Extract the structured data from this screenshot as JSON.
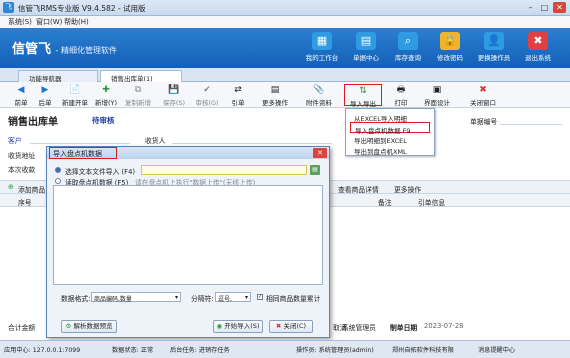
{
  "window": {
    "title": "信管飞RMS专业版 V9.4.582 - 试用版",
    "app_icon": "飞"
  },
  "menu": [
    "系统(S)",
    "窗口(W)",
    "帮助(H)"
  ],
  "banner": {
    "logo": "信管飞",
    "tagline": "- 精细化管理软件",
    "icons": [
      {
        "name": "workbench",
        "label": "我的工作台",
        "glyph": "▦",
        "color": "#2f9be3"
      },
      {
        "name": "document-center",
        "label": "单据中心",
        "glyph": "▤",
        "color": "#2f9be3"
      },
      {
        "name": "inventory-query",
        "label": "库存查询",
        "glyph": "⌕",
        "color": "#2f9be3"
      },
      {
        "name": "change-password",
        "label": "修改密码",
        "glyph": "🔒",
        "color": "#f0b42a"
      },
      {
        "name": "switch-operator",
        "label": "更换操作员",
        "glyph": "👤",
        "color": "#2f9be3"
      },
      {
        "name": "exit-system",
        "label": "退出系统",
        "glyph": "✖",
        "color": "#e04040"
      }
    ]
  },
  "tabs": [
    "功能导航器",
    "销售出库单(1)"
  ],
  "toolbar": [
    {
      "name": "prev",
      "label": "前单",
      "glyph": "◀"
    },
    {
      "name": "next",
      "label": "后单",
      "glyph": "▶"
    },
    {
      "name": "new-doc",
      "label": "新建开单",
      "glyph": "📄"
    },
    {
      "name": "add",
      "label": "新增(Y)",
      "glyph": "✚"
    },
    {
      "name": "copy-new",
      "label": "复制新增",
      "glyph": "⧉"
    },
    {
      "name": "save",
      "label": "保存(S)",
      "glyph": "💾"
    },
    {
      "name": "review",
      "label": "审核(G)",
      "glyph": "✔"
    },
    {
      "name": "reference",
      "label": "引单",
      "glyph": "⇄"
    },
    {
      "name": "more-ops",
      "label": "更多操作",
      "glyph": "▤"
    },
    {
      "name": "attachments",
      "label": "附件资料",
      "glyph": "📎"
    },
    {
      "name": "import-export",
      "label": "导入导出",
      "glyph": "⇅"
    },
    {
      "name": "print",
      "label": "打印",
      "glyph": "🖶"
    },
    {
      "name": "interface-design",
      "label": "界面设计",
      "glyph": "▣"
    },
    {
      "name": "close-window",
      "label": "关闭窗口",
      "glyph": "✖"
    }
  ],
  "form": {
    "title": "销售出库单",
    "reviewed": "待审核",
    "customer": "客户",
    "receiver": "收货人",
    "address": "收货地址",
    "this_time": "本次收款",
    "doc_no": "单据编号",
    "add_btn": "添加商品",
    "view_detail": "查看商品详情",
    "more_ops": "更多操作",
    "columns": [
      "序号",
      "备注",
      "引单信息"
    ],
    "total": "合计金额",
    "cancel_label": "取消",
    "operator": "系统管理员",
    "date_label": "制单日期",
    "date": "2023-07-28"
  },
  "dropdown": {
    "items": [
      "从EXCEL导入明细",
      "导入盘点机数据    F9",
      "导出明细到EXCEL",
      "导出到盘点机XML"
    ]
  },
  "dialog": {
    "title": "导入盘点机数据",
    "opt1": "选择文本文件导入 (F4)",
    "opt2": "读取盘点机数据 (F5)",
    "opt2_hint": "请在盘点机上执行\"数据上传\"(无线上传)",
    "format_label": "数据格式:",
    "format_value": "商品编码,数量",
    "sep_label": "分隔符:",
    "sep_value": "逗号,",
    "merge_label": "相同商品数量累计",
    "parse_btn": "解析数据预览",
    "start_btn": "开始导入(S)",
    "close_btn": "关闭(C)"
  },
  "status": {
    "server": "应用中心: 127.0.0.1:7099",
    "sync": "数据状态: 正常",
    "tasks": "后台任务: 进销存任务",
    "user": "操作员: 系统管理员(admin)",
    "company": "郑州自拓软件科技有限",
    "msg": "消息提醒中心"
  }
}
